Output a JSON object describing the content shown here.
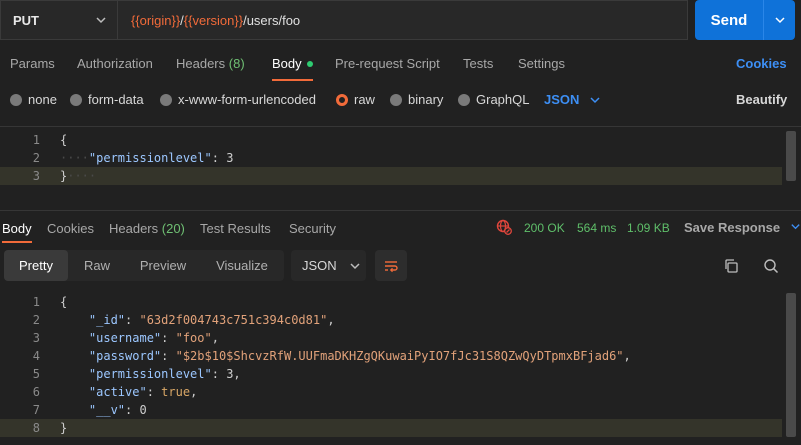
{
  "request": {
    "method": "PUT",
    "url_parts": [
      "{{origin}}",
      "/",
      "{{version}}",
      "/users/foo"
    ],
    "send_label": "Send"
  },
  "request_tabs": {
    "params": "Params",
    "authorization": "Authorization",
    "headers": "Headers",
    "headers_count": "(8)",
    "body": "Body",
    "pre_request": "Pre-request Script",
    "tests": "Tests",
    "settings": "Settings",
    "cookies": "Cookies"
  },
  "body_types": {
    "none": "none",
    "form_data": "form-data",
    "urlencoded": "x-www-form-urlencoded",
    "raw": "raw",
    "binary": "binary",
    "graphql": "GraphQL",
    "selected": "raw",
    "language": "JSON",
    "beautify": "Beautify"
  },
  "request_body": {
    "line_numbers": [
      "1",
      "2",
      "3"
    ],
    "lines": [
      "{",
      "    \"permissionlevel\": 3",
      "}"
    ],
    "key": "\"permissionlevel\"",
    "value": "3"
  },
  "response_tabs": {
    "body": "Body",
    "cookies": "Cookies",
    "headers": "Headers",
    "headers_count": "(20)",
    "test_results": "Test Results",
    "security": "Security"
  },
  "response_status": {
    "code": "200 OK",
    "time": "564 ms",
    "size": "1.09 KB",
    "save": "Save Response"
  },
  "response_toolbar": {
    "views": [
      "Pretty",
      "Raw",
      "Preview",
      "Visualize"
    ],
    "active_view": "Pretty",
    "format": "JSON"
  },
  "response_body": {
    "line_numbers": [
      "1",
      "2",
      "3",
      "4",
      "5",
      "6",
      "7",
      "8"
    ],
    "open_brace": "{",
    "close_brace": "}",
    "fields": [
      {
        "key": "\"_id\"",
        "value": "\"63d2f004743c751c394c0d81\"",
        "type": "string",
        "comma": ","
      },
      {
        "key": "\"username\"",
        "value": "\"foo\"",
        "type": "string",
        "comma": ","
      },
      {
        "key": "\"password\"",
        "value": "\"$2b$10$ShcvzRfW.UUFmaDKHZgQKuwaiPyIO7fJc31S8QZwQyDTpmxBFjad6\"",
        "type": "string",
        "comma": ","
      },
      {
        "key": "\"permissionlevel\"",
        "value": "3",
        "type": "number",
        "comma": ","
      },
      {
        "key": "\"active\"",
        "value": "true",
        "type": "keyword",
        "comma": ","
      },
      {
        "key": "\"__v\"",
        "value": "0",
        "type": "number",
        "comma": ""
      }
    ]
  },
  "colors": {
    "accent": "#f26b3a",
    "primary": "#0f72d9",
    "link": "#3d8ff5",
    "success": "#5fbf6a",
    "background": "#212121"
  }
}
